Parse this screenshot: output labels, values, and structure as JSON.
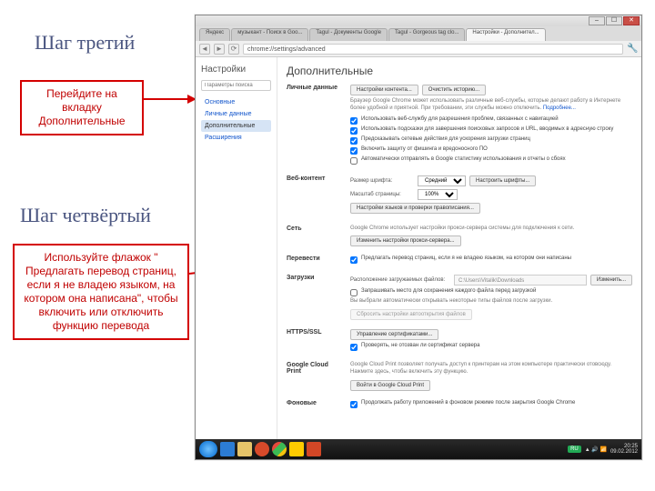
{
  "steps": {
    "three": {
      "title": "Шаг третий",
      "callout": "Перейдите на вкладку Дополнительные"
    },
    "four": {
      "title": "Шаг четвёртый",
      "callout": "Используйте флажок \" Предлагать перевод страниц, если я не владею языком, на котором она написана\", чтобы включить или отключить функцию перевода"
    }
  },
  "browser": {
    "window_buttons": {
      "min": "–",
      "max": "☐",
      "close": "✕"
    },
    "tabs": [
      {
        "label": "Яндекс"
      },
      {
        "label": "музыкант - Поиск в Goo..."
      },
      {
        "label": "Tagul - Документы Google"
      },
      {
        "label": "Tagul - Gorgeous tag clo..."
      },
      {
        "label": "Настройки - Дополнител..."
      }
    ],
    "active_tab": 4,
    "nav": {
      "back": "◄",
      "forward": "►",
      "reload": "⟳",
      "wrench": "🔧"
    },
    "url": "chrome://settings/advanced",
    "sidebar": {
      "title": "Настройки",
      "search_placeholder": "Параметры поиска",
      "items": [
        "Основные",
        "Личные данные",
        "Дополнительные",
        "Расширения"
      ],
      "active": 2
    },
    "main": {
      "title": "Дополнительные",
      "privacy": {
        "head": "Личные данные",
        "btn1": "Настройки контента...",
        "btn2": "Очистить историю...",
        "desc": "Браузер Google Chrome может использовать различные веб-службы, которые делают работу в Интернете более удобной и приятной. При требовании, эти службы можно отключить.",
        "more": "Подробнее...",
        "chk1": "Использовать веб-службу для разрешения проблем, связанных с навигацией",
        "chk2": "Использовать подсказки для завершения поисковых запросов и URL, вводимых в адресную строку",
        "chk3": "Предсказывать сетевые действия для ускорения загрузки страниц",
        "chk4": "Включить защиту от фишинга и вредоносного ПО",
        "chk5": "Автоматически отправлять в Google статистику использования и отчеты о сбоях"
      },
      "webcontent": {
        "head": "Веб-контент",
        "font_lbl": "Размер шрифта:",
        "font_val": "Средний",
        "font_btn": "Настроить шрифты...",
        "zoom_lbl": "Масштаб страницы:",
        "zoom_val": "100%",
        "lang_btn": "Настройки языков и проверки правописания..."
      },
      "network": {
        "head": "Сеть",
        "desc": "Google Chrome использует настройки прокси-сервера системы для подключения к сети.",
        "btn": "Изменить настройки прокси-сервера..."
      },
      "translate": {
        "head": "Перевести",
        "chk": "Предлагать перевод страниц, если я не владею языком, на котором они написаны"
      },
      "downloads": {
        "head": "Загрузки",
        "path_lbl": "Расположение загружаемых файлов:",
        "path_val": "C:\\Users\\Vitalik\\Downloads",
        "change_btn": "Изменить...",
        "chk1": "Запрашивать место для сохранения каждого файла перед загрузкой",
        "desc": "Вы выбрали автоматически открывать некоторые типы файлов после загрузки.",
        "btn_clear": "Сбросить настройки автооткрытия файлов"
      },
      "https": {
        "head": "HTTPS/SSL",
        "btn": "Управление сертификатами...",
        "chk": "Проверять, не отозван ли сертификат сервера"
      },
      "cloud": {
        "head": "Google Cloud Print",
        "desc": "Google Cloud Print позволяет получать доступ к принтерам на этом компьютере практически отовсюду. Нажмите здесь, чтобы включить эту функцию.",
        "btn": "Войти в Google Cloud Print"
      },
      "bg": {
        "head": "Фоновые",
        "chk": "Продолжать работу приложений в фоновом режиме после закрытия Google Chrome"
      }
    }
  },
  "taskbar": {
    "lang": "RU",
    "time": "20:25",
    "date": "09.02.2012"
  }
}
